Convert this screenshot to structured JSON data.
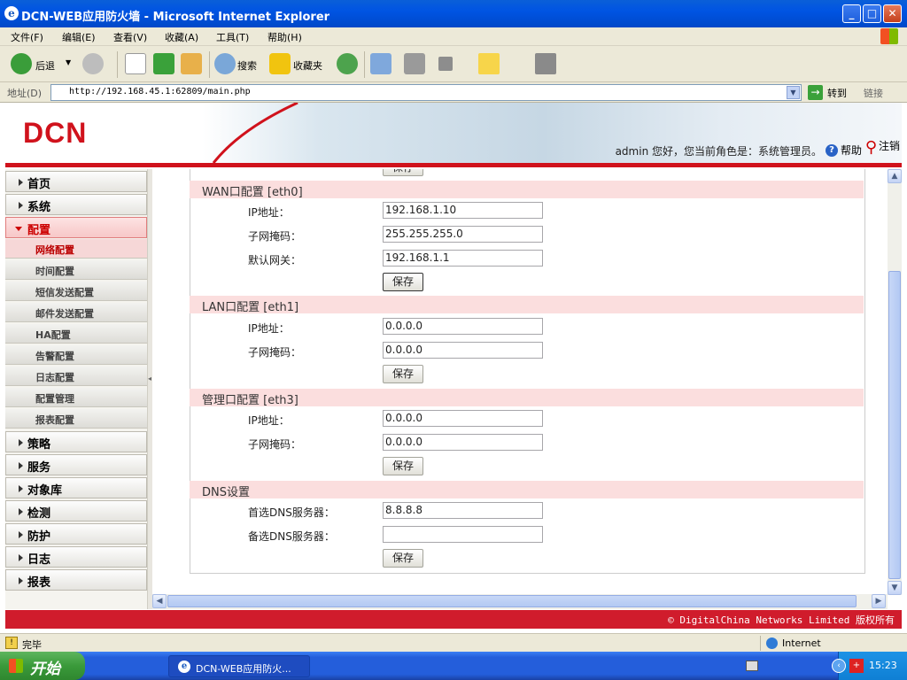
{
  "window": {
    "title": "DCN-WEB应用防火墙 - Microsoft Internet Explorer",
    "min": "_",
    "max": "□",
    "close": "✕"
  },
  "menubar": [
    "文件(F)",
    "编辑(E)",
    "查看(V)",
    "收藏(A)",
    "工具(T)",
    "帮助(H)"
  ],
  "toolbar": {
    "back": "后退",
    "search": "搜索",
    "favorites": "收藏夹"
  },
  "address": {
    "label": "地址(D)",
    "url": "http://192.168.45.1:62809/main.php",
    "go": "转到",
    "links": "链接"
  },
  "header": {
    "logo": "DCN",
    "user_line": "admin 您好，您当前角色是：系统管理员。",
    "help": "帮助",
    "logout": "注销"
  },
  "sidebar": {
    "top_items": [
      "首页",
      "系统",
      "配置"
    ],
    "sub_items": [
      "网络配置",
      "时间配置",
      "短信发送配置",
      "邮件发送配置",
      "HA配置",
      "告警配置",
      "日志配置",
      "配置管理",
      "报表配置"
    ],
    "bottom_items": [
      "策略",
      "服务",
      "对象库",
      "检测",
      "防护",
      "日志",
      "报表"
    ]
  },
  "form": {
    "top_partial_button": "保存",
    "wan": {
      "title": "WAN口配置  [eth0]",
      "ip_label": "IP地址：",
      "ip": "192.168.1.10",
      "mask_label": "子网掩码：",
      "mask": "255.255.255.0",
      "gw_label": "默认网关：",
      "gw": "192.168.1.1",
      "save": "保存"
    },
    "lan": {
      "title": "LAN口配置  [eth1]",
      "ip_label": "IP地址：",
      "ip": "0.0.0.0",
      "mask_label": "子网掩码：",
      "mask": "0.0.0.0",
      "save": "保存"
    },
    "mgmt": {
      "title": "管理口配置  [eth3]",
      "ip_label": "IP地址：",
      "ip": "0.0.0.0",
      "mask_label": "子网掩码：",
      "mask": "0.0.0.0",
      "save": "保存"
    },
    "dns": {
      "title": "DNS设置",
      "primary_label": "首选DNS服务器：",
      "primary": "8.8.8.8",
      "secondary_label": "备选DNS服务器：",
      "secondary": "",
      "save": "保存"
    }
  },
  "footer": "© DigitalChina Networks Limited 版权所有",
  "status": {
    "text": "完毕",
    "zone": "Internet"
  },
  "taskbar": {
    "start": "开始",
    "task": "DCN-WEB应用防火...",
    "clock": "15:23"
  }
}
